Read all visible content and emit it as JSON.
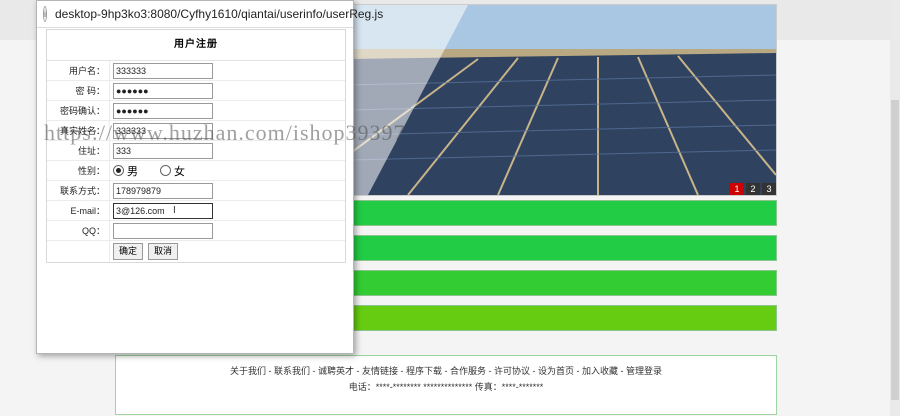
{
  "popup": {
    "address": "desktop-9hp3ko3:8080/Cyfhy1610/qiantai/userinfo/userReg.js"
  },
  "form": {
    "title": "用户注册",
    "labels": {
      "username": "用户名：",
      "password": "密 码：",
      "confirm": "密码确认：",
      "realname": "真实姓名：",
      "address": "住址：",
      "gender": "性别：",
      "contact": "联系方式：",
      "email": "E-mail：",
      "qq": "QQ："
    },
    "values": {
      "username": "333333",
      "password": "●●●●●●",
      "confirm": "●●●●●●",
      "realname": "333333",
      "address": "333",
      "contact": "178979879",
      "email": "3@126.com",
      "qq": ""
    },
    "gender_options": [
      "男",
      "女"
    ],
    "gender_selected": "男",
    "submit_label": "确定",
    "cancel_label": "取消"
  },
  "banner": {
    "slides": [
      "1",
      "2",
      "3"
    ],
    "active_slide": "1"
  },
  "bars": {
    "colors": [
      "#22cc44",
      "#22cc44",
      "#33cc33",
      "#66cc11"
    ]
  },
  "footer": {
    "links": "关于我们 - 联系我们 - 诚聘英才 - 友情链接 - 程序下载 - 合作服务 - 许可协议 - 设为首页 - 加入收藏 - 管理登录",
    "contact": "电话：****-******** ************** 传真：****-*******"
  },
  "watermark": "https://www.huzhan.com/ishop39397"
}
